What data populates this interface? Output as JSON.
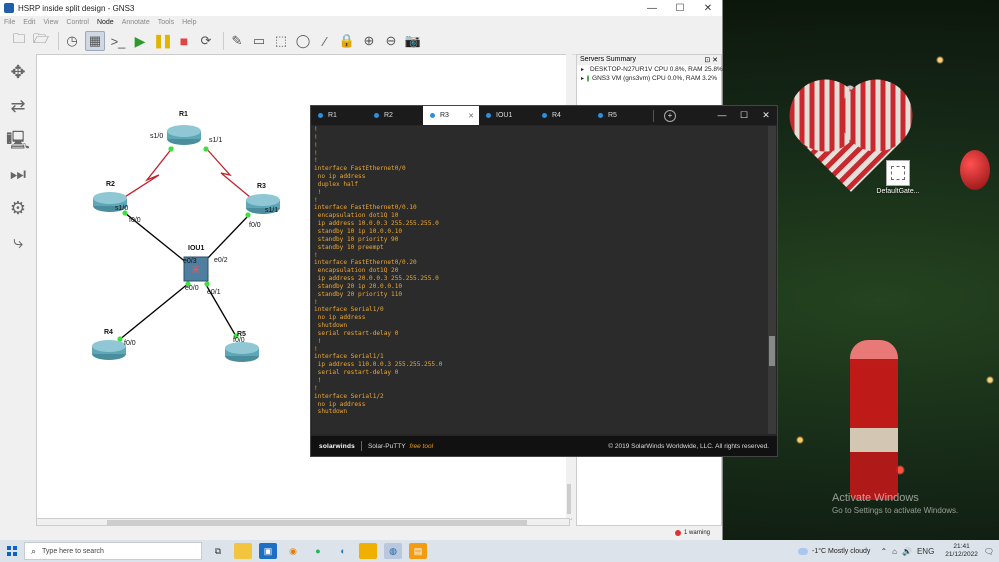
{
  "gns3": {
    "title": "HSRP inside split design - GNS3",
    "window_controls": {
      "minimize": "—",
      "maximize": "☐",
      "close": "✕"
    },
    "menu": [
      "File",
      "Edit",
      "View",
      "Control",
      "Node",
      "Annotate",
      "Tools",
      "Help"
    ],
    "servers": {
      "title": "Servers Summary",
      "header_icons": "⊡ ✕",
      "items": [
        {
          "label": "DESKTOP-N27UR1V CPU 0.8%, RAM 25.8%"
        },
        {
          "label": "GNS3 VM (gns3vm) CPU 0.0%, RAM 3.2%"
        }
      ]
    },
    "status": {
      "warning": "1 warning"
    },
    "topology": {
      "nodes": {
        "r1": "R1",
        "r2": "R2",
        "r3": "R3",
        "r4": "R4",
        "r5": "R5",
        "iou1": "IOU1"
      },
      "interfaces": {
        "r1_s10": "s1/0",
        "r1_s11": "s1/1",
        "r2_s10": "s1/0",
        "r2_f00": "f0/0",
        "r3_s11": "s1/1",
        "r3_f00": "f0/0",
        "iou_e03": "e0/3",
        "iou_e02": "e0/2",
        "iou_e00": "e0/0",
        "iou_e01": "e0/1",
        "r4_f00": "f0/0",
        "r5_f00": "f0/0"
      }
    }
  },
  "putty": {
    "tabs": [
      {
        "label": "R1"
      },
      {
        "label": "R2"
      },
      {
        "label": "R3"
      },
      {
        "label": "IOU1"
      },
      {
        "label": "R4"
      },
      {
        "label": "R5"
      }
    ],
    "active_tab": "R3",
    "tab_close": "✕",
    "window_controls": {
      "minimize": "—",
      "maximize": "☐",
      "close": "✕"
    },
    "terminal_lines": [
      "!",
      "!",
      "!",
      "!",
      "!",
      "interface FastEthernet0/0",
      " no ip address",
      " duplex half",
      " !",
      "!",
      "interface FastEthernet0/0.10",
      " encapsulation dot1Q 10",
      " ip address 10.0.0.3 255.255.255.0",
      " standby 10 ip 10.0.0.10",
      " standby 10 priority 90",
      " standby 10 preempt",
      "!",
      "interface FastEthernet0/0.20",
      " encapsulation dot1Q 20",
      " ip address 20.0.0.3 255.255.255.0",
      " standby 20 ip 20.0.0.10",
      " standby 20 priority 110",
      "!",
      "interface Serial1/0",
      " no ip address",
      " shutdown",
      " serial restart-delay 0",
      " !",
      "!",
      "interface Serial1/1",
      " ip address 110.0.0.3 255.255.255.0",
      " serial restart-delay 0",
      " !",
      "!",
      "interface Serial1/2",
      " no ip address",
      " shutdown"
    ],
    "footer": {
      "brand": "solarwinds",
      "product": "Solar-PuTTY",
      "free": "free tool",
      "copyright": "© 2019 SolarWinds Worldwide, LLC. All rights reserved."
    }
  },
  "desktop": {
    "file_label": "DefaultGate...",
    "activate_title": "Activate Windows",
    "activate_sub": "Go to Settings to activate Windows."
  },
  "taskbar": {
    "search_placeholder": "Type here to search",
    "weather": "-1°C  Mostly cloudy",
    "language": "ENG",
    "time": "21:41",
    "date": "21/12/2022"
  },
  "colors": {
    "terminal_text": "#f0a830",
    "terminal_bg": "#2b2b2b",
    "link_serial": "#c0202a",
    "link_ethernet": "#000000",
    "port_up": "#3ee03e",
    "accent": "#2f8fd9"
  }
}
